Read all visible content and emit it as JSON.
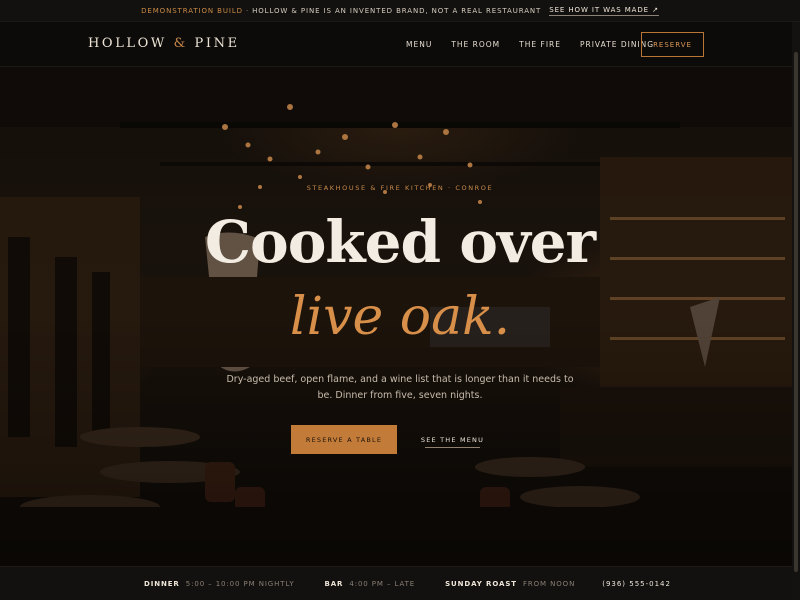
{
  "announcement": {
    "tag": "Demonstration build",
    "separator": "·",
    "text": "Hollow & Pine is an invented brand, not a real restaurant",
    "link": "See how it was made ↗"
  },
  "header": {
    "logo_part1": "HOLLOW",
    "logo_amp": "&",
    "logo_part2": "PINE",
    "nav": [
      "Menu",
      "The Room",
      "The Fire",
      "Private Dining"
    ],
    "reserve_label": "Reserve"
  },
  "hero": {
    "eyebrow": "Steakhouse & Fire Kitchen · Conroe",
    "headline_line1": "Cooked over",
    "headline_line2": "live oak.",
    "subtext": "Dry-aged beef, open flame, and a wine list that is longer than it needs to be. Dinner from five, seven nights.",
    "primary_cta": "Reserve a table",
    "secondary_cta": "See the menu"
  },
  "info": {
    "items": [
      {
        "label": "Dinner",
        "value": "5:00 – 10:00 PM nightly"
      },
      {
        "label": "Bar",
        "value": "4:00 PM – late"
      },
      {
        "label": "Sunday Roast",
        "value": "From noon"
      }
    ],
    "phone": "(936) 555-0142"
  },
  "colors": {
    "accent": "#c27b38",
    "accent_text": "#d88f49",
    "background": "#0f0c09"
  }
}
